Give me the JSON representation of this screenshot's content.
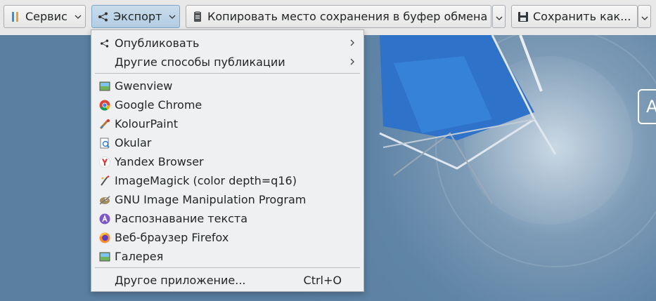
{
  "toolbar": {
    "service": {
      "label": "Сервис",
      "icon": "tools-icon"
    },
    "export": {
      "label": "Экспорт",
      "icon": "share-icon"
    },
    "copy_location": {
      "label": "Копировать место сохранения в буфер обмена",
      "icon": "clipboard-icon"
    },
    "save_as": {
      "label": "Сохранить как...",
      "icon": "floppy-icon"
    }
  },
  "menu": {
    "items": [
      {
        "label": "Опубликовать",
        "icon": "share-icon",
        "has_submenu": true
      },
      {
        "label": "Другие способы публикации",
        "has_submenu": true
      },
      {
        "label": "Gwenview",
        "icon": "gwenview-icon"
      },
      {
        "label": "Google Chrome",
        "icon": "chrome-icon"
      },
      {
        "label": "KolourPaint",
        "icon": "kolourpaint-icon"
      },
      {
        "label": "Okular",
        "icon": "okular-icon"
      },
      {
        "label": "Yandex Browser",
        "icon": "yandex-icon"
      },
      {
        "label": "ImageMagick (color depth=q16)",
        "icon": "imagemagick-icon"
      },
      {
        "label": "GNU Image Manipulation Program",
        "icon": "gimp-icon"
      },
      {
        "label": "Распознавание текста",
        "icon": "ocr-icon"
      },
      {
        "label": "Веб-браузер Firefox",
        "icon": "firefox-icon"
      },
      {
        "label": "Галерея",
        "icon": "gallery-icon"
      },
      {
        "label": "Другое приложение...",
        "shortcut": "Ctrl+O"
      }
    ]
  },
  "desktop": {
    "partial_widget_text": "A"
  },
  "colors": {
    "accent": "#3daee9",
    "menu_bg": "#eff0f1",
    "desktop_bg": "#5f84a6"
  }
}
